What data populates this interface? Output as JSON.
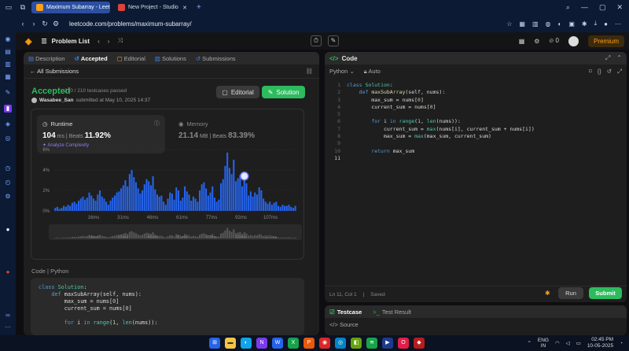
{
  "browser": {
    "tabs": [
      {
        "label": "Maximum Subarray - Leet",
        "active": true
      },
      {
        "label": "New Project - Studio",
        "active": false
      }
    ],
    "new_tab": "+",
    "url": "leetcode.com/problems/maximum-subarray/"
  },
  "header": {
    "problem_list": "Problem List",
    "premium": "Premium",
    "fire_count": "0"
  },
  "left_panel": {
    "tabs": [
      {
        "label": "Description"
      },
      {
        "label": "Accepted"
      },
      {
        "label": "Editorial"
      },
      {
        "label": "Solutions"
      },
      {
        "label": "Submissions"
      }
    ],
    "back_label": "All Submissions",
    "status": "Accepted",
    "passed": "210 / 210 testcases passed",
    "user": "Wasabee_San",
    "submitted": "submitted at May 10, 2025 14:37",
    "editorial_btn": "Editorial",
    "solution_btn": "Solution",
    "runtime": {
      "label": "Runtime",
      "value": "104",
      "unit": "ms",
      "beats_label": "Beats",
      "beats": "11.92%",
      "link": "Analyze Complexity"
    },
    "memory": {
      "label": "Memory",
      "value": "21.14",
      "unit": "MB",
      "beats_label": "Beats",
      "beats": "83.39%"
    },
    "code_label": "Code",
    "code_lang": "Python",
    "code_preview": "class Solution:\n    def maxSubArray(self, nums):\n        max_sum = nums[0]\n        current_sum = nums[0]\n\n        for i in range(1, len(nums)):"
  },
  "chart_data": {
    "type": "bar",
    "yticks": [
      "6%",
      "4%",
      "2%",
      "0%"
    ],
    "ylim": [
      0,
      6
    ],
    "xticks": [
      "16ms",
      "31ms",
      "46ms",
      "61ms",
      "77ms",
      "92ms",
      "107ms"
    ],
    "values": [
      0.3,
      0.4,
      0.2,
      0.3,
      0.5,
      0.4,
      0.6,
      0.5,
      0.8,
      0.9,
      0.7,
      1.0,
      1.2,
      1.4,
      1.1,
      1.3,
      1.8,
      1.5,
      1.2,
      1.0,
      1.6,
      2.0,
      1.4,
      1.2,
      0.9,
      0.6,
      1.0,
      1.3,
      1.5,
      1.8,
      1.9,
      2.2,
      2.5,
      3.0,
      2.4,
      3.6,
      4.0,
      3.3,
      2.8,
      2.2,
      1.7,
      2.0,
      2.6,
      3.1,
      2.9,
      2.5,
      3.4,
      2.1,
      1.6,
      1.4,
      1.5,
      0.9,
      0.6,
      1.2,
      1.8,
      1.7,
      1.1,
      2.3,
      2.0,
      1.0,
      1.3,
      2.4,
      1.9,
      1.6,
      1.0,
      1.4,
      1.2,
      0.9,
      2.0,
      2.6,
      2.8,
      2.2,
      1.5,
      1.8,
      2.4,
      1.3,
      0.9,
      1.1,
      2.7,
      3.1,
      4.4,
      5.7,
      4.2,
      3.6,
      5.0,
      2.9,
      3.2,
      3.5,
      2.4,
      3.4,
      2.7,
      1.5,
      1.9,
      1.4,
      1.8,
      1.6,
      2.3,
      2.0,
      1.2,
      0.9,
      0.7,
      0.9,
      0.6,
      0.8,
      0.9,
      0.5,
      0.4,
      0.6,
      0.5,
      0.5,
      0.6,
      0.4,
      0.3,
      0.5
    ],
    "highlight_index": 89,
    "grid": true
  },
  "editor": {
    "title": "Code",
    "lang": "Python",
    "auto": "Auto",
    "status_pos": "Ln 11, Col 1",
    "status_saved": "Saved",
    "run": "Run",
    "submit": "Submit"
  },
  "test": {
    "tab1": "Testcase",
    "tab2": "Test Result",
    "source": "Source"
  },
  "taskbar": {
    "lang1": "ENG",
    "lang2": "IN",
    "time": "02:45 PM",
    "date": "10-05-2025"
  }
}
